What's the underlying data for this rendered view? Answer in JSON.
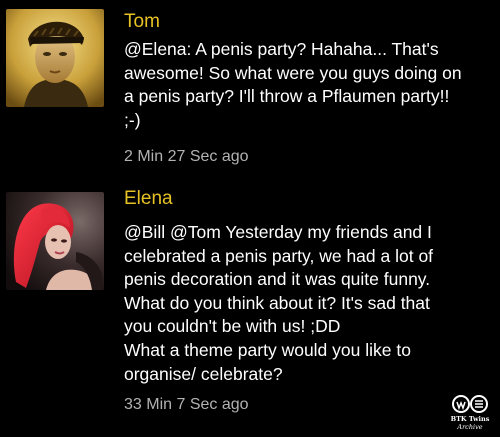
{
  "feed": {
    "posts": [
      {
        "author": "Tom",
        "message": "@Elena: A penis party? Hahaha... That's\nawesome! So what were you guys doing on\na penis party? I'll throw a Pflaumen party!!\n;-)",
        "time": "2 Min 27 Sec ago"
      },
      {
        "author": "Elena",
        "message": "@Bill @Tom Yesterday my friends and I\ncelebrated a penis party, we had a lot of\npenis decoration and it was quite funny.\nWhat do you think about it? It's sad that\nyou couldn't be with us! ;DD\nWhat a theme party would you like to\norganise/ celebrate?",
        "time": "33 Min 7 Sec ago"
      }
    ]
  },
  "watermark": {
    "text": "BTK Twins Archive"
  },
  "colors": {
    "background": "#000000",
    "author": "#e7c224",
    "message": "#ffffff",
    "timestamp": "#b2b2b2"
  }
}
